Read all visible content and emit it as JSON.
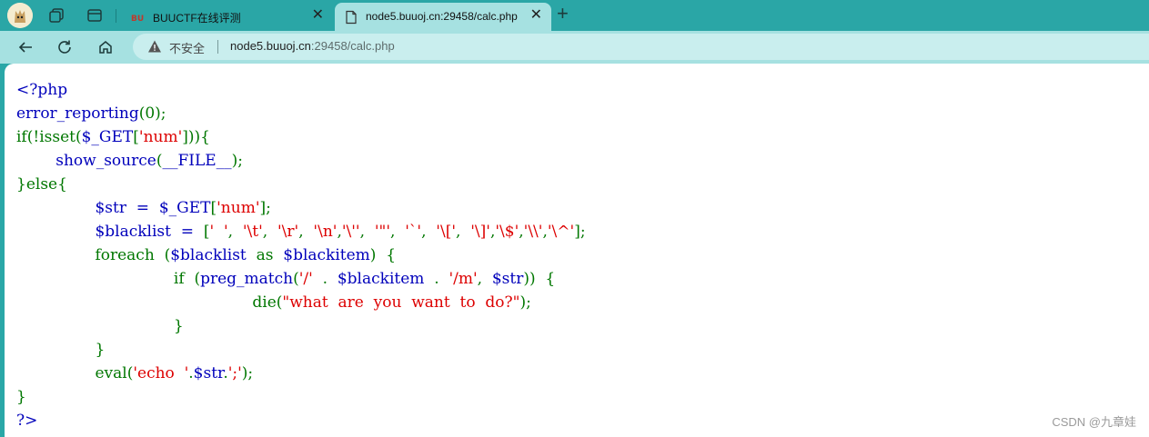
{
  "browser": {
    "tabs": [
      {
        "title": "BUUCTF在线评测",
        "active": false
      },
      {
        "title": "node5.buuoj.cn:29458/calc.php",
        "active": true
      }
    ],
    "security_label": "不安全",
    "url_host": "node5.buuoj.cn",
    "url_path": ":29458/calc.php",
    "theme_color": "#2aa7a7",
    "toolbar_color": "#a6e1e1"
  },
  "code_lines": [
    [
      [
        "vr",
        "<?php"
      ]
    ],
    [
      [
        "vr",
        "error_reporting"
      ],
      [
        "kw",
        "(0);"
      ]
    ],
    [
      [
        "kw",
        "if(!isset("
      ],
      [
        "vr",
        "$_GET"
      ],
      [
        "kw",
        "["
      ],
      [
        "st",
        "'num'"
      ],
      [
        "kw",
        "])){"
      ]
    ],
    [
      [
        "kw",
        "        "
      ],
      [
        "vr",
        "show_source"
      ],
      [
        "kw",
        "("
      ],
      [
        "vr",
        "__FILE__"
      ],
      [
        "kw",
        ");"
      ]
    ],
    [
      [
        "kw",
        "}else{"
      ]
    ],
    [
      [
        "kw",
        "                "
      ],
      [
        "vr",
        "$str  =  $_GET"
      ],
      [
        "kw",
        "["
      ],
      [
        "st",
        "'num'"
      ],
      [
        "kw",
        "];"
      ]
    ],
    [
      [
        "kw",
        "                "
      ],
      [
        "vr",
        "$blacklist  =  "
      ],
      [
        "kw",
        "["
      ],
      [
        "st",
        "'  '"
      ],
      [
        "kw",
        ",  "
      ],
      [
        "st",
        "'\\t'"
      ],
      [
        "kw",
        ",  "
      ],
      [
        "st",
        "'\\r'"
      ],
      [
        "kw",
        ",  "
      ],
      [
        "st",
        "'\\n'"
      ],
      [
        "kw",
        ","
      ],
      [
        "st",
        "'\\''"
      ],
      [
        "kw",
        ",  "
      ],
      [
        "st",
        "'\"'"
      ],
      [
        "kw",
        ",  "
      ],
      [
        "st",
        "'`'"
      ],
      [
        "kw",
        ",  "
      ],
      [
        "st",
        "'\\['"
      ],
      [
        "kw",
        ",  "
      ],
      [
        "st",
        "'\\]'"
      ],
      [
        "kw",
        ","
      ],
      [
        "st",
        "'\\$'"
      ],
      [
        "kw",
        ","
      ],
      [
        "st",
        "'\\\\'"
      ],
      [
        "kw",
        ","
      ],
      [
        "st",
        "'\\^'"
      ],
      [
        "kw",
        "];"
      ]
    ],
    [
      [
        "kw",
        "                foreach  ("
      ],
      [
        "vr",
        "$blacklist  "
      ],
      [
        "kw",
        "as  "
      ],
      [
        "vr",
        "$blackitem"
      ],
      [
        "kw",
        ")  {"
      ]
    ],
    [
      [
        "kw",
        "                                if  ("
      ],
      [
        "vr",
        "preg_match"
      ],
      [
        "kw",
        "("
      ],
      [
        "st",
        "'/'  "
      ],
      [
        "kw",
        ".  "
      ],
      [
        "vr",
        "$blackitem  "
      ],
      [
        "kw",
        ".  "
      ],
      [
        "st",
        "'/m'"
      ],
      [
        "kw",
        ",  "
      ],
      [
        "vr",
        "$str"
      ],
      [
        "kw",
        "))  {"
      ]
    ],
    [
      [
        "kw",
        "                                                die("
      ],
      [
        "st",
        "\"what  are  you  want  to  do?\""
      ],
      [
        "kw",
        ");"
      ]
    ],
    [
      [
        "kw",
        "                                }"
      ]
    ],
    [
      [
        "kw",
        "                }"
      ]
    ],
    [
      [
        "kw",
        "                eval("
      ],
      [
        "st",
        "'echo  '"
      ],
      [
        "kw",
        "."
      ],
      [
        "vr",
        "$str"
      ],
      [
        "kw",
        "."
      ],
      [
        "st",
        "';'"
      ],
      [
        "kw",
        ");"
      ]
    ],
    [
      [
        "kw",
        "}"
      ]
    ],
    [
      [
        "vr",
        "?>"
      ]
    ]
  ],
  "watermark": "CSDN @九章娃"
}
